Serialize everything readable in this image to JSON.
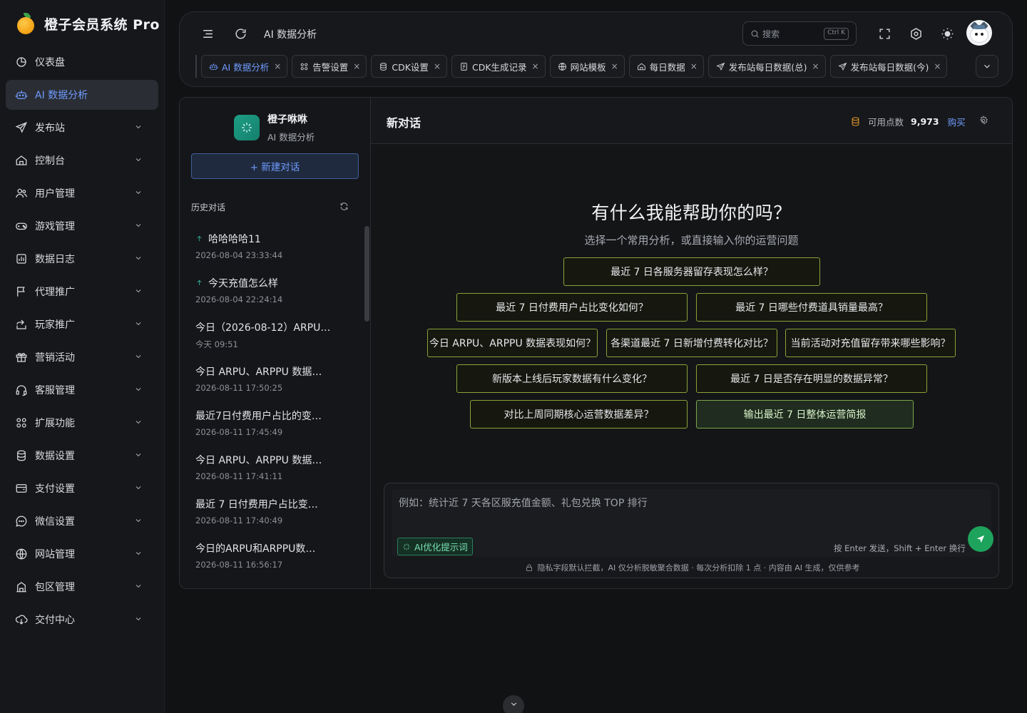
{
  "app": {
    "title": "橙子会员系统 Pro"
  },
  "sidebar": {
    "items": [
      {
        "label": "仪表盘",
        "icon": "dashboard-icon",
        "expandable": false
      },
      {
        "label": "AI 数据分析",
        "icon": "robot-icon",
        "expandable": false,
        "active": true
      },
      {
        "label": "发布站",
        "icon": "send-icon",
        "expandable": true
      },
      {
        "label": "控制台",
        "icon": "home-icon",
        "expandable": true
      },
      {
        "label": "用户管理",
        "icon": "users-icon",
        "expandable": true
      },
      {
        "label": "游戏管理",
        "icon": "gamepad-icon",
        "expandable": true
      },
      {
        "label": "数据日志",
        "icon": "chart-icon",
        "expandable": true
      },
      {
        "label": "代理推广",
        "icon": "flag-icon",
        "expandable": true
      },
      {
        "label": "玩家推广",
        "icon": "share-icon",
        "expandable": true
      },
      {
        "label": "营销活动",
        "icon": "gift-icon",
        "expandable": true
      },
      {
        "label": "客服管理",
        "icon": "headset-icon",
        "expandable": true
      },
      {
        "label": "扩展功能",
        "icon": "apps-icon",
        "expandable": true
      },
      {
        "label": "数据设置",
        "icon": "database-icon",
        "expandable": true
      },
      {
        "label": "支付设置",
        "icon": "wallet-icon",
        "expandable": true
      },
      {
        "label": "微信设置",
        "icon": "chat-bubble-icon",
        "expandable": true
      },
      {
        "label": "网站管理",
        "icon": "globe-icon",
        "expandable": true
      },
      {
        "label": "包区管理",
        "icon": "building-icon",
        "expandable": true
      },
      {
        "label": "交付中心",
        "icon": "cloud-download-icon",
        "expandable": true
      }
    ]
  },
  "header": {
    "breadcrumb": "AI 数据分析",
    "search": {
      "placeholder": "搜索",
      "shortcut": "Ctrl K"
    },
    "tabs": [
      {
        "label": "AI 数据分析",
        "icon": "robot-icon",
        "active": true
      },
      {
        "label": "告警设置",
        "icon": "apps-icon"
      },
      {
        "label": "CDK设置",
        "icon": "database-icon"
      },
      {
        "label": "CDK生成记录",
        "icon": "document-icon"
      },
      {
        "label": "网站模板",
        "icon": "globe-icon"
      },
      {
        "label": "每日数据",
        "icon": "home-icon"
      },
      {
        "label": "发布站每日数据(总)",
        "icon": "send-icon"
      },
      {
        "label": "发布站每日数据(今)",
        "icon": "send-icon"
      }
    ],
    "tab_close": "×"
  },
  "assistant": {
    "name": "橙子咻咻",
    "subtitle": "AI 数据分析",
    "new_chat_label": "+ 新建对话",
    "history_title": "历史对话",
    "history": [
      {
        "title": "哈哈哈哈11",
        "date": "2026-08-04 23:33:44",
        "pinned": true
      },
      {
        "title": "今天充值怎么样",
        "date": "2026-08-04 22:24:14",
        "pinned": true
      },
      {
        "title": "今日（2026-08-12）ARPU…",
        "date": "今天 09:51",
        "pinned": false
      },
      {
        "title": "今日 ARPU、ARPPU 数据…",
        "date": "2026-08-11 17:50:25",
        "pinned": false
      },
      {
        "title": "最近7日付费用户占比的变…",
        "date": "2026-08-11 17:45:49",
        "pinned": false
      },
      {
        "title": "今日 ARPU、ARPPU 数据…",
        "date": "2026-08-11 17:41:11",
        "pinned": false
      },
      {
        "title": "最近 7 日付费用户占比变…",
        "date": "2026-08-11 17:40:49",
        "pinned": false
      },
      {
        "title": "今日的ARPU和ARPPU数…",
        "date": "2026-08-11 16:56:17",
        "pinned": false
      }
    ]
  },
  "chat": {
    "title": "新对话",
    "credits_label": "可用点数",
    "credits_value": "9,973",
    "buy_label": "购买",
    "welcome_heading": "有什么我能帮助你的吗？",
    "welcome_sub": "选择一个常用分析，或直接输入你的运营问题",
    "suggestions": [
      {
        "text": "最近 7 日各服务器留存表现怎么样？"
      },
      {
        "text": "最近 7 日付费用户占比变化如何？"
      },
      {
        "text": "最近 7 日哪些付费道具销量最高？"
      },
      {
        "text": "今日 ARPU、ARPPU 数据表现如何？"
      },
      {
        "text": "各渠道最近 7 日新增付费转化对比？"
      },
      {
        "text": "当前活动对充值留存带来哪些影响？"
      },
      {
        "text": "新版本上线后玩家数据有什么变化？"
      },
      {
        "text": "最近 7 日是否存在明显的数据异常？"
      },
      {
        "text": "对比上周同期核心运营数据差异？"
      },
      {
        "text": "输出最近 7 日整体运营简报",
        "highlighted": true
      }
    ],
    "input_placeholder": "例如：统计近 7 天各区服充值金额、礼包兑换 TOP 排行",
    "ai_optimize_label": "AI优化提示词",
    "send_hint": "按 Enter 发送，Shift + Enter 换行",
    "privacy_note": "隐私字段默认拦截，AI 仅分析脱敏聚合数据 · 每次分析扣除 1 点 · 内容由 AI 生成，仅供参考"
  },
  "colors": {
    "accent": "#6f9cff",
    "send": "#1ea35c",
    "suggestion_border": "#8aa23a",
    "brand_orange": "#f3a012"
  }
}
